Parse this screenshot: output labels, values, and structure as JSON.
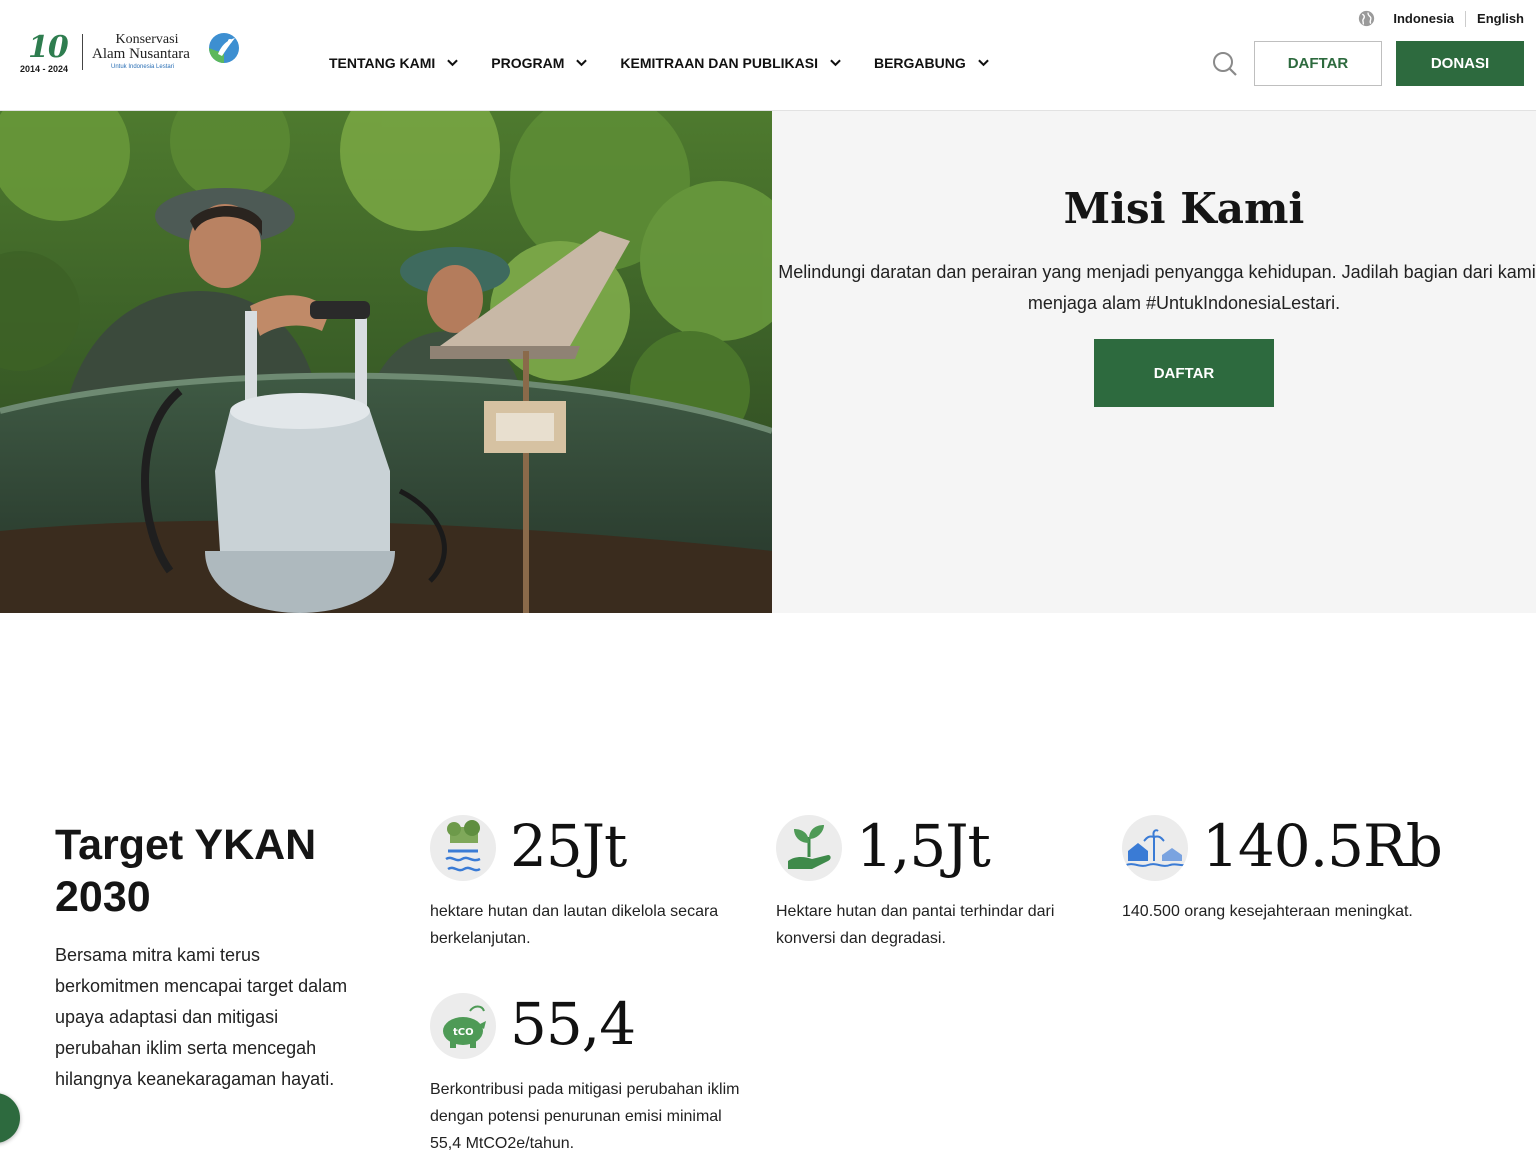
{
  "brand": {
    "logo_number": "10",
    "logo_years": "2014 - 2024",
    "name_line1": "Konservasi",
    "name_line2": "Alam Nusantara",
    "tagline": "Untuk Indonesia Lestari"
  },
  "language": {
    "icon": "globe-icon",
    "options": [
      "Indonesia",
      "English"
    ]
  },
  "nav": {
    "items": [
      {
        "label": "TENTANG KAMI"
      },
      {
        "label": "PROGRAM"
      },
      {
        "label": "KEMITRAAN DAN PUBLIKASI"
      },
      {
        "label": "BERGABUNG"
      }
    ]
  },
  "header_actions": {
    "search_icon": "search-icon",
    "register_label": "DAFTAR",
    "donate_label": "DONASI"
  },
  "hero": {
    "title": "Misi Kami",
    "text": "Melindungi daratan dan perairan yang menjadi penyangga kehidupan. Jadilah bagian dari kami dalam menjaga alam #UntukIndonesiaLestari.",
    "button_label": "DAFTAR"
  },
  "targets": {
    "title": "Target YKAN 2030",
    "text": "Bersama mitra kami terus berkomitmen mencapai target dalam upaya adaptasi dan mitigasi perubahan iklim serta mencegah hilangnya keanekaragaman hayati.",
    "stats": [
      {
        "icon": "landscape-icon",
        "value": "25Jt",
        "desc": "hektare hutan dan lautan dikelola secara berkelanjutan."
      },
      {
        "icon": "seedling-hand-icon",
        "value": "1,5Jt",
        "desc": "Hektare hutan dan pantai terhindar dari konversi dan degradasi."
      },
      {
        "icon": "village-icon",
        "value": "140.5Rb",
        "desc": "140.500 orang kesejahteraan meningkat."
      },
      {
        "icon": "carbon-piggy-icon",
        "value": "55,4",
        "desc": "Berkontribusi pada mitigasi perubahan iklim dengan potensi penurunan emisi minimal 55,4 MtCO2e/tahun."
      }
    ]
  },
  "colors": {
    "brand_green": "#2d6a3e",
    "panel_bg": "#f5f5f5"
  }
}
